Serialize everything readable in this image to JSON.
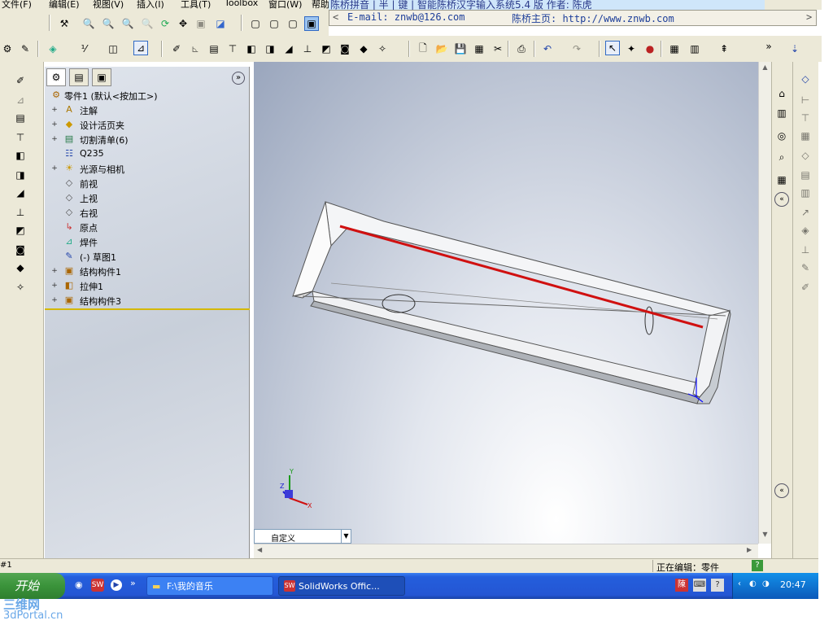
{
  "menubar": {
    "items": [
      "文件(F)",
      "编辑(E)",
      "视图(V)",
      "插入(I)",
      "工具(T)",
      "Toolbox",
      "窗口(W)",
      "帮助"
    ],
    "ime_title": "陈桥拼音 | 半 | 键 |   智能陈桥汉字输入系统5.4 版    作者: 陈虎"
  },
  "ime_bar": {
    "email": "E-mail: znwb@126.com",
    "homepage": "陈桥主页: http://www.znwb.com"
  },
  "feature_tree": {
    "items": [
      {
        "label": "零件1  (默认<按加工>)",
        "icon": "part-icon",
        "expandable": false
      },
      {
        "label": "注解",
        "icon": "annotation-icon",
        "expandable": true
      },
      {
        "label": "设计活页夹",
        "icon": "design-binder-icon",
        "expandable": true
      },
      {
        "label": "切割清单(6)",
        "icon": "cut-list-icon",
        "expandable": true
      },
      {
        "label": "Q235",
        "icon": "material-icon",
        "expandable": false
      },
      {
        "label": "光源与相机",
        "icon": "lights-cameras-icon",
        "expandable": true
      },
      {
        "label": "前视",
        "icon": "plane-icon",
        "expandable": false
      },
      {
        "label": "上视",
        "icon": "plane-icon",
        "expandable": false
      },
      {
        "label": "右视",
        "icon": "plane-icon",
        "expandable": false
      },
      {
        "label": "原点",
        "icon": "origin-icon",
        "expandable": false
      },
      {
        "label": "焊件",
        "icon": "weldment-icon",
        "expandable": false
      },
      {
        "label": "(-) 草图1",
        "icon": "sketch-icon",
        "expandable": false
      },
      {
        "label": "结构构件1",
        "icon": "structural-member-icon",
        "expandable": true
      },
      {
        "label": "拉伸1",
        "icon": "extrude-icon",
        "expandable": true
      },
      {
        "label": "结构构件3",
        "icon": "structural-member-icon",
        "expandable": true
      }
    ]
  },
  "viewport": {
    "view_dropdown": "自定义",
    "triad": {
      "x": "X",
      "y": "Y",
      "z": "Z"
    }
  },
  "statusbar": {
    "left": "#1",
    "editing": "正在编辑：零件",
    "help": "?"
  },
  "taskbar": {
    "start": "开始",
    "tasks": [
      "F:\\我的音乐",
      "SolidWorks Offic..."
    ],
    "clock": "20:47"
  },
  "watermark": {
    "line1": "三维网",
    "line2": "3dPortal.cn"
  },
  "colors": {
    "accent_red": "#d01010",
    "tree_bg": "#d4dae4",
    "taskbar": "#245edc"
  }
}
